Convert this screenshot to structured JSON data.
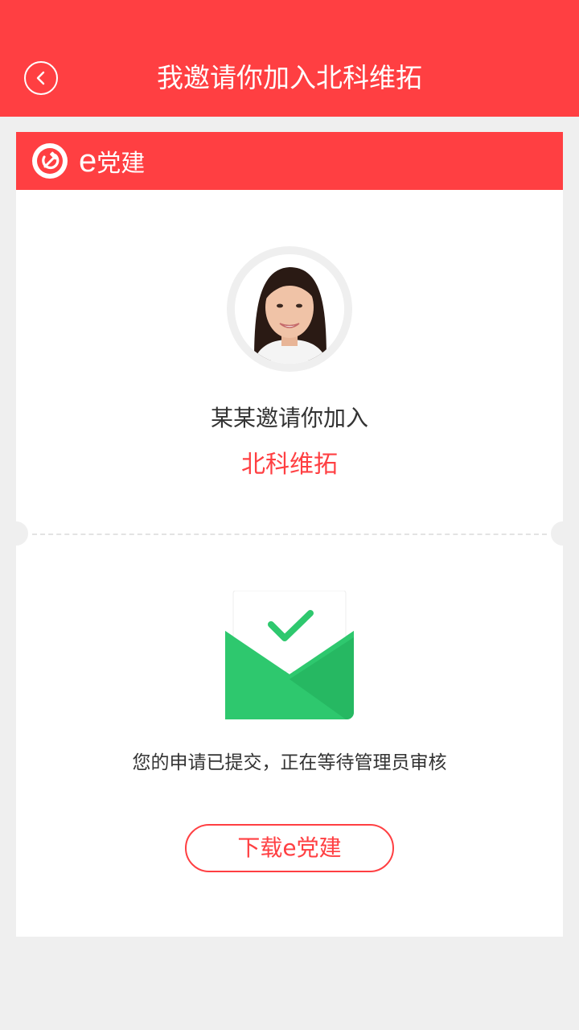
{
  "header": {
    "title": "我邀请你加入北科维拓",
    "back_icon": "chevron-left-icon"
  },
  "brand": {
    "e": "e",
    "name": "党建",
    "logo_icon": "hammer-sickle-icon"
  },
  "invite": {
    "avatar_icon": "user-avatar",
    "inviter_line": "某某邀请你加入",
    "org_name": "北科维拓"
  },
  "status": {
    "icon": "envelope-check-icon",
    "message": "您的申请已提交，正在等待管理员审核"
  },
  "download_button": {
    "label": "下载e党建"
  },
  "colors": {
    "primary": "#ff3f42",
    "success": "#2ec86e",
    "background": "#efefef"
  }
}
